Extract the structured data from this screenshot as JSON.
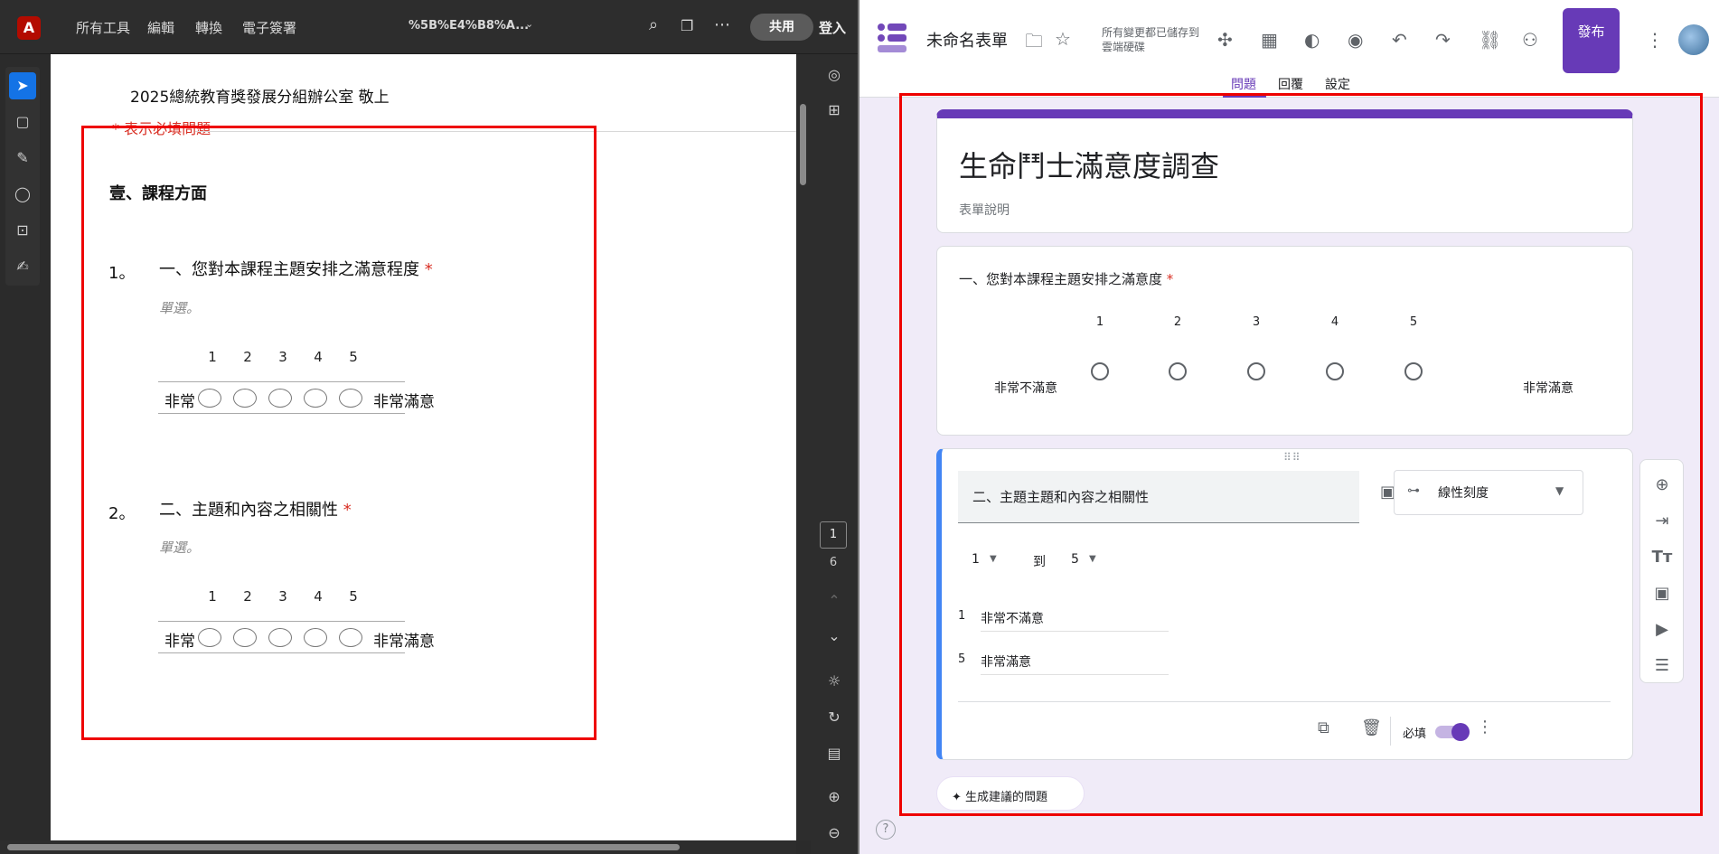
{
  "acrobat": {
    "logo_glyph": "A",
    "menu": [
      "所有工具",
      "編輯",
      "轉換",
      "電子簽署"
    ],
    "filename": "%5B%E4%B8%A...",
    "share_label": "共用",
    "login_label": "登入",
    "document": {
      "header_line": "2025總統教育獎發展分組辦公室  敬上",
      "required_note": "* 表示必填問題",
      "section": "壹、課程方面",
      "questions": [
        {
          "num": "1。",
          "title": "一、您對本課程主題安排之滿意程度",
          "star": "*",
          "hint": "單選。",
          "scale": [
            "1",
            "2",
            "3",
            "4",
            "5"
          ],
          "low": "非常不滿意",
          "high": "非常滿意"
        },
        {
          "num": "2。",
          "title": "二、主題和內容之相關性",
          "star": "*",
          "hint": "單選。",
          "scale": [
            "1",
            "2",
            "3",
            "4",
            "5"
          ],
          "low": "非常不滿意",
          "high": "非常滿意"
        }
      ]
    },
    "page_current": "1",
    "page_total": "6"
  },
  "forms": {
    "title": "未命名表單",
    "saved_status": "所有變更都已儲存到雲端硬碟",
    "publish_label": "發布",
    "tabs": [
      "問題",
      "回覆",
      "設定"
    ],
    "form_title": "生命鬥士滿意度調查",
    "form_desc": "表單說明",
    "q1": {
      "title": "一、您對本課程主題安排之滿意度",
      "star": "*",
      "scale": [
        "1",
        "2",
        "3",
        "4",
        "5"
      ],
      "low": "非常不滿意",
      "high": "非常滿意"
    },
    "q2": {
      "title": "二、主題主題和內容之相關性",
      "type_label": "線性刻度",
      "range_from": "1",
      "range_to_word": "到",
      "range_to": "5",
      "label1_num": "1",
      "label1_text": "非常不滿意",
      "label5_num": "5",
      "label5_text": "非常滿意",
      "required_label": "必填",
      "required_on": true
    },
    "suggest_label": "✦ 生成建議的問題",
    "accent": "#673ab7"
  }
}
